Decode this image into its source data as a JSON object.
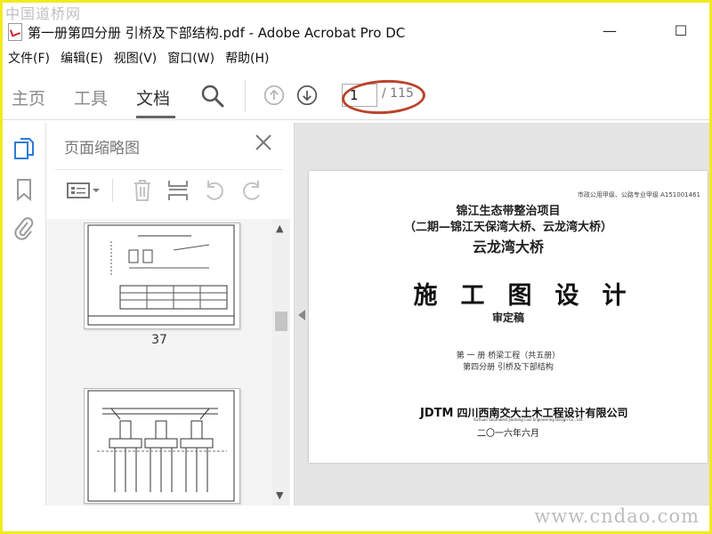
{
  "watermarks": {
    "top": "中国道桥网",
    "bottom": "www.cndao.com"
  },
  "window": {
    "title": "第一册第四分册 引桥及下部结构.pdf - Adobe Acrobat Pro DC",
    "controls": {
      "minimize": "—",
      "maximize": "☐"
    }
  },
  "menu": [
    "文件(F)",
    "编辑(E)",
    "视图(V)",
    "窗口(W)",
    "帮助(H)"
  ],
  "toolbar": {
    "tabs": [
      "主页",
      "工具",
      "文档"
    ],
    "active_tab": "文档",
    "current_page": "1",
    "total_pages": "/ 115"
  },
  "panel": {
    "title": "页面缩略图",
    "thumb_labels": [
      "37"
    ]
  },
  "document": {
    "series_header": "市政公用甲级、公路专业甲级   A151001461",
    "project_line1": "锦江生态带整治项目",
    "project_line2": "（二期—锦江天保湾大桥、云龙湾大桥）",
    "project_line3": "云龙湾大桥",
    "main_title": "施工图设计",
    "subtitle": "审定稿",
    "volume_line1": "第 一 册   桥梁工程（共五册）",
    "volume_line2": "第四分册   引桥及下部结构",
    "company_logo": "JDTM",
    "company_name": "四川西南交大土木工程设计有限公司",
    "company_name_en": "Sichuan Southwest Jiaotong Civil Engineering Design Co., Ltd.",
    "date": "二〇一六年六月"
  },
  "colors": {
    "frame": "#f2ea1f",
    "ellipse": "#b9442a",
    "active_icon": "#2b7bd6"
  },
  "icons": [
    "pdf-file-icon",
    "search-icon",
    "arrow-up-icon",
    "arrow-down-icon",
    "pages-icon",
    "bookmark-icon",
    "paperclip-icon",
    "close-icon",
    "options-icon",
    "trash-icon",
    "insert-page-icon",
    "undo-icon",
    "redo-icon"
  ]
}
